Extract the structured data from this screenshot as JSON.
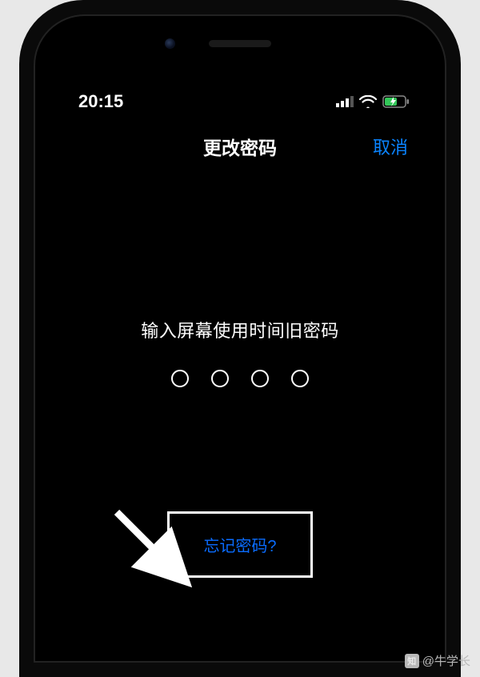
{
  "status": {
    "time": "20:15"
  },
  "nav": {
    "title": "更改密码",
    "cancel": "取消"
  },
  "content": {
    "prompt": "输入屏幕使用时间旧密码",
    "forgot": "忘记密码?"
  },
  "watermark": {
    "text": "@牛学长"
  }
}
